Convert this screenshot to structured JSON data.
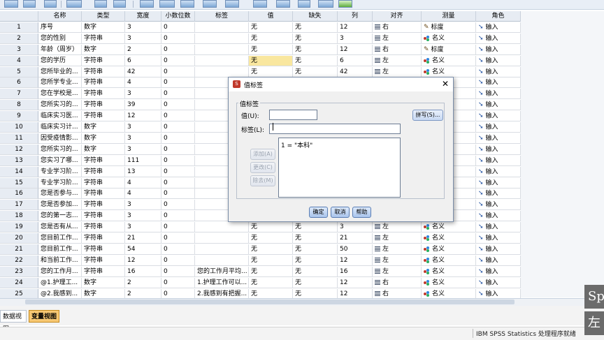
{
  "columns": [
    "名称",
    "类型",
    "宽度",
    "小数位数",
    "标签",
    "值",
    "缺失",
    "列",
    "对齐",
    "测量",
    "角色"
  ],
  "rows": [
    {
      "num": "1",
      "name": "序号",
      "type": "数字",
      "width": "3",
      "dec": "0",
      "label": "",
      "value": "无",
      "missing": "无",
      "cols": "12",
      "align": "右",
      "measure": "标度",
      "role": "输入",
      "mk": "scale"
    },
    {
      "num": "2",
      "name": "您的性别",
      "type": "字符串",
      "width": "3",
      "dec": "0",
      "label": "",
      "value": "无",
      "missing": "无",
      "cols": "3",
      "align": "左",
      "measure": "名义",
      "role": "输入",
      "mk": "nominal"
    },
    {
      "num": "3",
      "name": "年龄（周岁）",
      "type": "数字",
      "width": "2",
      "dec": "0",
      "label": "",
      "value": "无",
      "missing": "无",
      "cols": "12",
      "align": "右",
      "measure": "标度",
      "role": "输入",
      "mk": "scale"
    },
    {
      "num": "4",
      "name": "您的学历",
      "type": "字符串",
      "width": "6",
      "dec": "0",
      "label": "",
      "value": "无",
      "missing": "无",
      "cols": "6",
      "align": "左",
      "measure": "名义",
      "role": "输入",
      "mk": "nominal",
      "hl": true
    },
    {
      "num": "5",
      "name": "您所毕业的...",
      "type": "字符串",
      "width": "42",
      "dec": "0",
      "label": "",
      "value": "无",
      "missing": "无",
      "cols": "42",
      "align": "左",
      "measure": "名义",
      "role": "输入",
      "mk": "nominal"
    },
    {
      "num": "6",
      "name": "您所学专业...",
      "type": "字符串",
      "width": "4",
      "dec": "0",
      "label": "",
      "value": "",
      "missing": "",
      "cols": "",
      "align": "",
      "measure": "",
      "role": "输入",
      "mk": ""
    },
    {
      "num": "7",
      "name": "您在学校是...",
      "type": "字符串",
      "width": "3",
      "dec": "0",
      "label": "",
      "value": "",
      "missing": "",
      "cols": "",
      "align": "",
      "measure": "",
      "role": "输入",
      "mk": ""
    },
    {
      "num": "8",
      "name": "您所实习的...",
      "type": "字符串",
      "width": "39",
      "dec": "0",
      "label": "",
      "value": "",
      "missing": "",
      "cols": "",
      "align": "",
      "measure": "",
      "role": "输入",
      "mk": ""
    },
    {
      "num": "9",
      "name": "临床实习医...",
      "type": "字符串",
      "width": "12",
      "dec": "0",
      "label": "",
      "value": "",
      "missing": "",
      "cols": "",
      "align": "",
      "measure": "",
      "role": "输入",
      "mk": ""
    },
    {
      "num": "10",
      "name": "临床实习计...",
      "type": "数字",
      "width": "3",
      "dec": "0",
      "label": "",
      "value": "",
      "missing": "",
      "cols": "",
      "align": "",
      "measure": "",
      "role": "输入",
      "mk": ""
    },
    {
      "num": "11",
      "name": "因受疫情影...",
      "type": "数字",
      "width": "3",
      "dec": "0",
      "label": "",
      "value": "",
      "missing": "",
      "cols": "",
      "align": "",
      "measure": "",
      "role": "输入",
      "mk": ""
    },
    {
      "num": "12",
      "name": "您所实习的...",
      "type": "数字",
      "width": "3",
      "dec": "0",
      "label": "",
      "value": "",
      "missing": "",
      "cols": "",
      "align": "",
      "measure": "",
      "role": "输入",
      "mk": ""
    },
    {
      "num": "13",
      "name": "您实习了哪...",
      "type": "字符串",
      "width": "111",
      "dec": "0",
      "label": "",
      "value": "",
      "missing": "",
      "cols": "",
      "align": "",
      "measure": "",
      "role": "输入",
      "mk": ""
    },
    {
      "num": "14",
      "name": "专业学习阶...",
      "type": "字符串",
      "width": "13",
      "dec": "0",
      "label": "",
      "value": "",
      "missing": "",
      "cols": "",
      "align": "",
      "measure": "",
      "role": "输入",
      "mk": ""
    },
    {
      "num": "15",
      "name": "专业学习阶...",
      "type": "字符串",
      "width": "4",
      "dec": "0",
      "label": "",
      "value": "",
      "missing": "",
      "cols": "",
      "align": "",
      "measure": "",
      "role": "输入",
      "mk": ""
    },
    {
      "num": "16",
      "name": "您是否参与...",
      "type": "字符串",
      "width": "4",
      "dec": "0",
      "label": "",
      "value": "",
      "missing": "",
      "cols": "",
      "align": "",
      "measure": "",
      "role": "输入",
      "mk": ""
    },
    {
      "num": "17",
      "name": "您是否参加...",
      "type": "字符串",
      "width": "3",
      "dec": "0",
      "label": "",
      "value": "",
      "missing": "",
      "cols": "",
      "align": "",
      "measure": "",
      "role": "输入",
      "mk": ""
    },
    {
      "num": "18",
      "name": "您的第一志...",
      "type": "字符串",
      "width": "3",
      "dec": "0",
      "label": "",
      "value": "",
      "missing": "",
      "cols": "",
      "align": "",
      "measure": "",
      "role": "输入",
      "mk": ""
    },
    {
      "num": "19",
      "name": "您是否有从...",
      "type": "字符串",
      "width": "3",
      "dec": "0",
      "label": "",
      "value": "无",
      "missing": "无",
      "cols": "3",
      "align": "左",
      "measure": "名义",
      "role": "输入",
      "mk": "nominal"
    },
    {
      "num": "20",
      "name": "您目前工作...",
      "type": "字符串",
      "width": "21",
      "dec": "0",
      "label": "",
      "value": "无",
      "missing": "无",
      "cols": "21",
      "align": "左",
      "measure": "名义",
      "role": "输入",
      "mk": "nominal"
    },
    {
      "num": "21",
      "name": "您目前工作...",
      "type": "字符串",
      "width": "54",
      "dec": "0",
      "label": "",
      "value": "无",
      "missing": "无",
      "cols": "50",
      "align": "左",
      "measure": "名义",
      "role": "输入",
      "mk": "nominal"
    },
    {
      "num": "22",
      "name": "和当前工作...",
      "type": "字符串",
      "width": "12",
      "dec": "0",
      "label": "",
      "value": "无",
      "missing": "无",
      "cols": "12",
      "align": "左",
      "measure": "名义",
      "role": "输入",
      "mk": "nominal"
    },
    {
      "num": "23",
      "name": "您的工作月...",
      "type": "字符串",
      "width": "16",
      "dec": "0",
      "label": "您的工作月平均...",
      "value": "无",
      "missing": "无",
      "cols": "16",
      "align": "左",
      "measure": "名义",
      "role": "输入",
      "mk": "nominal"
    },
    {
      "num": "24",
      "name": "@1.护理工...",
      "type": "数字",
      "width": "2",
      "dec": "0",
      "label": "1.护理工作可以...",
      "value": "无",
      "missing": "无",
      "cols": "12",
      "align": "右",
      "measure": "名义",
      "role": "输入",
      "mk": "nominal"
    },
    {
      "num": "25",
      "name": "@2.我感到...",
      "type": "数字",
      "width": "2",
      "dec": "0",
      "label": "2.我感到有把握...",
      "value": "无",
      "missing": "无",
      "cols": "12",
      "align": "右",
      "measure": "名义",
      "role": "输入",
      "mk": "nominal"
    }
  ],
  "tabs": {
    "data_view": "数据视图",
    "variable_view": "变量视图"
  },
  "status": {
    "text": "IBM SPSS Statistics 处理程序就绪"
  },
  "side": {
    "top": "Sp",
    "bottom": "左"
  },
  "dialog": {
    "title": "值标签",
    "close": "✕",
    "group_label": "值标签",
    "value_label": "值(U):",
    "value_input": "",
    "label_label": "标签(L):",
    "label_input": "",
    "list_items": [
      "1 = \"本科\""
    ],
    "spell_button": "拼写(S)...",
    "add_button": "添加(A)",
    "change_button": "更改(C)",
    "remove_button": "除去(M)",
    "ok_button": "确定",
    "cancel_button": "取消",
    "help_button": "帮助"
  },
  "colors": {
    "highlight": "#f9e79f",
    "active_tab": "#f7c873",
    "header": "#e7ecf3"
  }
}
